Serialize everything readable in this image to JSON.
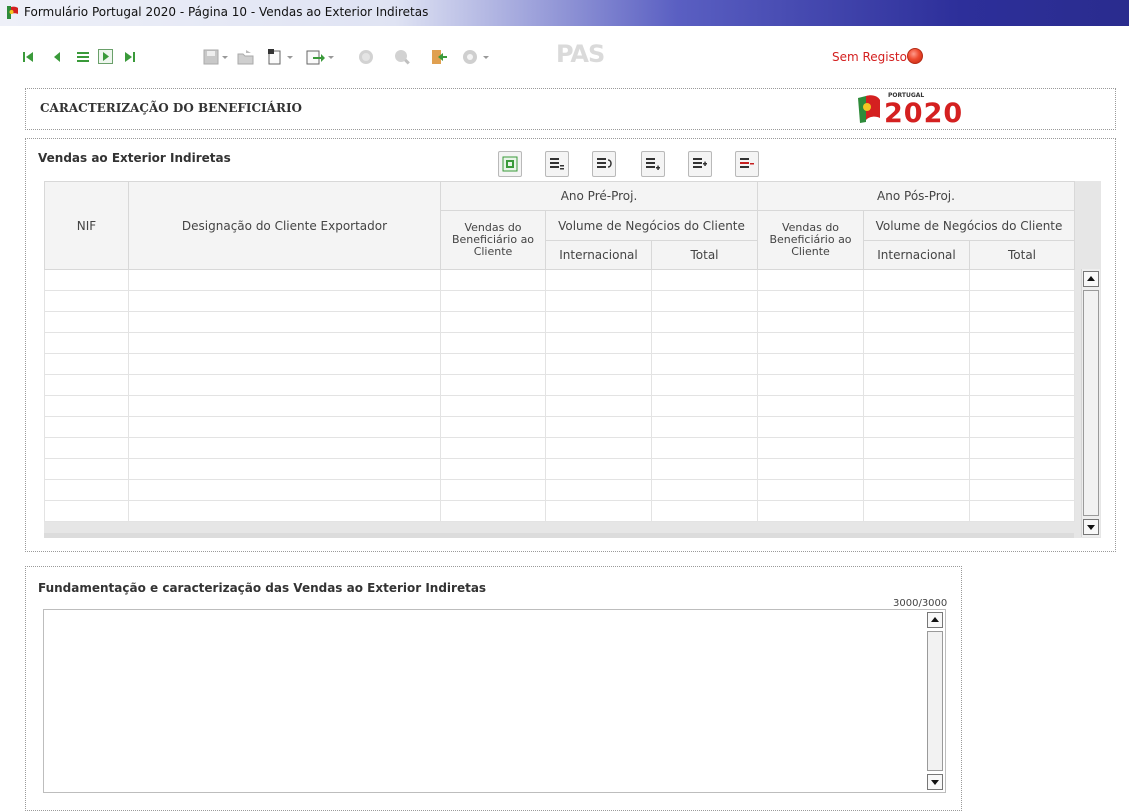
{
  "window": {
    "title": "Formulário Portugal 2020 - Página 10 - Vendas ao Exterior Indiretas"
  },
  "toolbar": {
    "nav_icons": [
      "first-page-icon",
      "previous-page-icon",
      "page-list-icon",
      "next-page-icon",
      "last-page-icon"
    ],
    "action_icons": [
      "save-icon",
      "open-icon",
      "new-icon",
      "export-icon",
      "validate-icon",
      "search-icon",
      "exit-icon",
      "settings-icon",
      "pas-icon"
    ],
    "pas_label": "PAS",
    "status_text": "Sem Registo",
    "status_color": "#e8442b"
  },
  "header": {
    "title": "CARACTERIZAÇÃO DO BENEFICIÁRIO",
    "logo_small": "PORTUGAL",
    "logo_year": "2020"
  },
  "sales_panel": {
    "title": "Vendas ao Exterior Indiretas",
    "grid_buttons": [
      "import-excel-icon",
      "insert-row-icon",
      "undo-row-icon",
      "add-row-icon",
      "append-row-icon",
      "delete-row-icon"
    ],
    "columns": {
      "nif": "NIF",
      "designacao": "Designação do Cliente Exportador",
      "pre_group": "Ano Pré-Proj.",
      "pos_group": "Ano Pós-Proj.",
      "vendas": "Vendas do Beneficiário ao Cliente",
      "volume": "Volume de Negócios do Cliente",
      "internacional": "Internacional",
      "total": "Total"
    },
    "row_count": 12
  },
  "justification": {
    "title": "Fundamentação e caracterização das Vendas ao Exterior Indiretas",
    "counter": "3000/3000",
    "value": ""
  },
  "colors": {
    "accent_red": "#d42020",
    "title_grad_end": "#2a2c8e"
  }
}
